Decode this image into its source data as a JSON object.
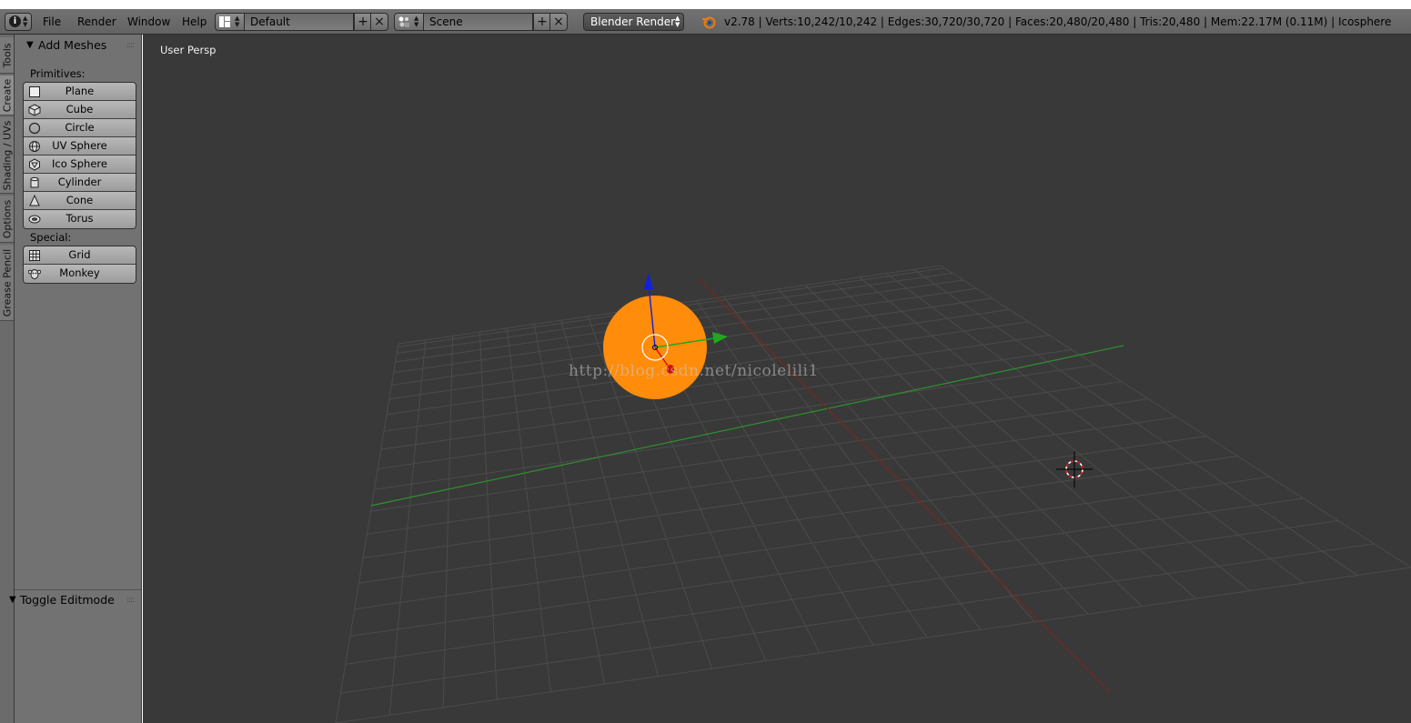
{
  "header": {
    "editor_type_icon": "info-icon",
    "menus": [
      "File",
      "Render",
      "Window",
      "Help"
    ],
    "screen_layout": {
      "icon": "screen-layout-icon",
      "value": "Default"
    },
    "scene": {
      "icon": "scene-icon",
      "value": "Scene"
    },
    "render_engine": "Blender Render",
    "stats": "v2.78 | Verts:10,242/10,242 | Edges:30,720/30,720 | Faces:20,480/20,480 | Tris:20,480 | Mem:22.17M (0.11M) | Icosphere"
  },
  "tabs": [
    "Tools",
    "Create",
    "Shading / UVs",
    "Options",
    "Grease Pencil"
  ],
  "active_tab": "Create",
  "toolshelf": {
    "panel_title": "Add Meshes",
    "primitives_label": "Primitives:",
    "primitives": [
      {
        "label": "Plane",
        "icon": "plane-icon"
      },
      {
        "label": "Cube",
        "icon": "cube-icon"
      },
      {
        "label": "Circle",
        "icon": "circle-icon"
      },
      {
        "label": "UV Sphere",
        "icon": "uv-sphere-icon"
      },
      {
        "label": "Ico Sphere",
        "icon": "ico-sphere-icon"
      },
      {
        "label": "Cylinder",
        "icon": "cylinder-icon"
      },
      {
        "label": "Cone",
        "icon": "cone-icon"
      },
      {
        "label": "Torus",
        "icon": "torus-icon"
      }
    ],
    "special_label": "Special:",
    "special": [
      {
        "label": "Grid",
        "icon": "grid-icon"
      },
      {
        "label": "Monkey",
        "icon": "monkey-icon"
      }
    ],
    "operator_panel_title": "Toggle Editmode"
  },
  "viewport": {
    "view_name": "User Persp",
    "watermark": "http://blog.csdn.net/nicolelili1",
    "object_color": "#ff8c0a",
    "axis_colors": {
      "x": "#d01010",
      "y": "#1fa81f",
      "z": "#1020e0"
    }
  }
}
